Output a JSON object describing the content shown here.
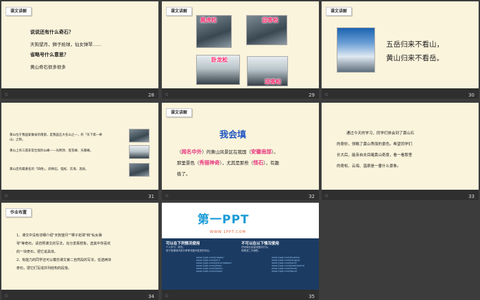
{
  "slides": {
    "s28": {
      "num": "28",
      "tag": "课文讲解",
      "q1": "说说还有什么奇石？",
      "a1": "天狗望月，狮子抢球，仙女弹琴……",
      "q2": "省略号什么意思？",
      "a2": "黄山奇石很多很多"
    },
    "s29": {
      "num": "29",
      "tag": "课文讲解",
      "labels": [
        "黑虎松",
        "迎客松",
        "卧龙松",
        "送客松"
      ]
    },
    "s30": {
      "num": "30",
      "tag": "课文讲解",
      "line1": "五岳归来不看山，",
      "line2": "黄山归来不看岳。"
    },
    "s31": {
      "num": "31",
      "p1a": "黄山位于我国安徽省的南部，是我国五大名山之一，有「天下第一奇",
      "p1b": "山」之称。",
      "p2": "黄山上有三座非常壮观的山峰——光明顶、莲花峰、天都峰。",
      "p3": "黄山还有最著名的「四绝」，即奇石、怪松、云海、温泉。"
    },
    "s32": {
      "num": "32",
      "tag": "课文讲解",
      "title": "我会填",
      "l1a": "（",
      "f1": "闻名中外",
      "l1b": "）的黄山风景区在我国（",
      "f2": "安徽南部",
      "l1c": "）。",
      "l2a": "那里景色（",
      "f3": "秀丽神奇",
      "l2b": "），尤其是那些（",
      "f4": "怪石",
      "l2c": "），有趣",
      "l3": "极了。"
    },
    "s33": {
      "num": "33",
      "t1": "通过今天的学习，同学们体会到了黄山石",
      "t2": "的奇妙，领略了黄山秀丽的景色。希望同学们",
      "t3": "长大后，能亲自去目睹黄山奇景，看一看那里",
      "t4": "的奇松、云海、温泉是一番什么景象。"
    },
    "s34": {
      "num": "34",
      "tag": "作业布置",
      "h1": "1、课文中没有详细介绍\"天狗望月\"\"狮子抢球\"和\"仙女弹",
      "h2": "琴\"等奇石，请仿照课文的写法，充分发挥想象，选其中你喜欢",
      "h3": "的一块奇石，把它说具体。",
      "h4": "2、有能力的同学还可以模仿课文第二自然段的写法，任选两块",
      "h5": "奇石，把它们写成并列结构的段落。"
    },
    "s35": {
      "num": "35",
      "brand": "第一PPT",
      "url": "WWW.1PPT.COM",
      "col1": "可以在下列情况使用",
      "col2": "不可以在以下情况使用",
      "c1a": "个人学习、研究。",
      "c1b": "用于授课或内部分享等非盈利性质的场合。",
      "c2a": "任何商业用途或盈利行为。",
      "c2b": "转载或二次销售。",
      "links": [
        "www.1ppt.com/moban/",
        "www.1ppt.com/jieri/",
        "www.1ppt.com/shouchaobao/",
        "www.1ppt.com/ziliao/",
        "www.1ppt.com/kejian/",
        "www.1ppt.com/xiazai/",
        "www.1ppt.com/fanwen/",
        "www.1ppt.com/hangye/",
        "www.1ppt.com/jianli/",
        "www.1ppt.com/powerpoint/",
        "www.1ppt.com/excel/",
        "www.1ppt.com/word/"
      ]
    }
  },
  "colors": {
    "accent_red": "#d31a1a",
    "fill_pink": "#e7367d",
    "blue_title": "#1f55c2",
    "bg_cream": "#fbf4dc"
  }
}
